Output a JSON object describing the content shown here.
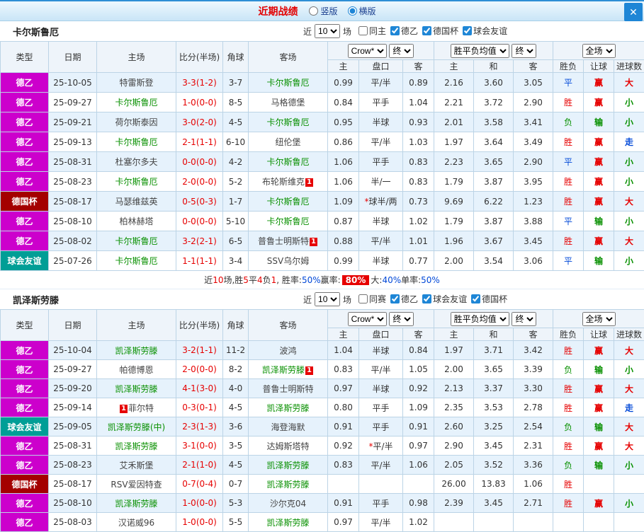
{
  "colors": {
    "accent_blue": "#1e86d6",
    "title_red": "#e30000",
    "league_d2": "#cc00cc",
    "league_cup": "#a40000",
    "league_friendly": "#009e96",
    "team_green": "#089000",
    "win_red": "#e60000",
    "loss_green": "#089000",
    "draw_blue": "#0048d8"
  },
  "topbar": {
    "title": "近期战绩",
    "layout_options": [
      {
        "label": "竖版",
        "selected": false
      },
      {
        "label": "横版",
        "selected": true
      }
    ],
    "close_icon": "✕"
  },
  "color_map": {
    "胜": "c-red",
    "平": "c-blue",
    "负": "c-green",
    "赢": "c-red",
    "输": "c-green",
    "大": "c-red",
    "小": "c-green",
    "走": "c-blue"
  },
  "type_class_map": {
    "德乙": "t-d2",
    "德国杯": "t-cup",
    "球会友谊": "t-fr"
  },
  "table_header": {
    "cols": [
      "类型",
      "日期",
      "主场",
      "比分(半场)",
      "角球",
      "客场"
    ],
    "odds_select": "Crow*",
    "final_select": "终",
    "avg_select": "胜平负均值",
    "scope_select": "全场",
    "sub": [
      "主",
      "盘口",
      "客",
      "主",
      "和",
      "客",
      "胜负",
      "让球",
      "进球数"
    ]
  },
  "sections": [
    {
      "team": "卡尔斯鲁厄",
      "filters": {
        "near": "近",
        "count": "10",
        "unit": "场",
        "checks": [
          {
            "label": "同主",
            "checked": false
          },
          {
            "label": "德乙",
            "checked": true
          },
          {
            "label": "德国杯",
            "checked": true
          },
          {
            "label": "球会友谊",
            "checked": true
          }
        ]
      },
      "rows": [
        {
          "ty": "德乙",
          "dt": "25-10-05",
          "hm": {
            "n": "特雷斯登"
          },
          "sc": "3-3(1-2)",
          "cn": "3-7",
          "aw": {
            "n": "卡尔斯鲁厄",
            "g": 1
          },
          "o1": "0.99",
          "hc": "平/半",
          "o2": "0.89",
          "w": "2.16",
          "d": "3.60",
          "l": "3.05",
          "rs": "平",
          "hr": "赢",
          "gl": "大"
        },
        {
          "ty": "德乙",
          "dt": "25-09-27",
          "hm": {
            "n": "卡尔斯鲁厄",
            "g": 1
          },
          "sc": "1-0(0-0)",
          "cn": "8-5",
          "aw": {
            "n": "马格德堡"
          },
          "o1": "0.84",
          "hc": "平手",
          "o2": "1.04",
          "w": "2.21",
          "d": "3.72",
          "l": "2.90",
          "rs": "胜",
          "hr": "赢",
          "gl": "小"
        },
        {
          "ty": "德乙",
          "dt": "25-09-21",
          "hm": {
            "n": "荷尔斯泰因"
          },
          "sc": "3-0(2-0)",
          "cn": "4-5",
          "aw": {
            "n": "卡尔斯鲁厄",
            "g": 1
          },
          "o1": "0.95",
          "hc": "半球",
          "o2": "0.93",
          "w": "2.01",
          "d": "3.58",
          "l": "3.41",
          "rs": "负",
          "hr": "输",
          "gl": "小"
        },
        {
          "ty": "德乙",
          "dt": "25-09-13",
          "hm": {
            "n": "卡尔斯鲁厄",
            "g": 1
          },
          "sc": "2-1(1-1)",
          "cn": "6-10",
          "aw": {
            "n": "纽伦堡"
          },
          "o1": "0.86",
          "hc": "平/半",
          "o2": "1.03",
          "w": "1.97",
          "d": "3.64",
          "l": "3.49",
          "rs": "胜",
          "hr": "赢",
          "gl": "走"
        },
        {
          "ty": "德乙",
          "dt": "25-08-31",
          "hm": {
            "n": "杜塞尔多夫"
          },
          "sc": "0-0(0-0)",
          "cn": "4-2",
          "aw": {
            "n": "卡尔斯鲁厄",
            "g": 1
          },
          "o1": "1.06",
          "hc": "平手",
          "o2": "0.83",
          "w": "2.23",
          "d": "3.65",
          "l": "2.90",
          "rs": "平",
          "hr": "赢",
          "gl": "小"
        },
        {
          "ty": "德乙",
          "dt": "25-08-23",
          "hm": {
            "n": "卡尔斯鲁厄",
            "g": 1
          },
          "sc": "2-0(0-0)",
          "cn": "5-2",
          "aw": {
            "n": "布轮斯维克",
            "b": "1"
          },
          "o1": "1.06",
          "hc": "半/一",
          "o2": "0.83",
          "w": "1.79",
          "d": "3.87",
          "l": "3.95",
          "rs": "胜",
          "hr": "赢",
          "gl": "小"
        },
        {
          "ty": "德国杯",
          "dt": "25-08-17",
          "hm": {
            "n": "马瑟维兹英"
          },
          "sc": "0-5(0-3)",
          "cn": "1-7",
          "aw": {
            "n": "卡尔斯鲁厄",
            "g": 1
          },
          "o1": "1.09",
          "hc": "*球半/两",
          "o2": "0.73",
          "w": "9.69",
          "d": "6.22",
          "l": "1.23",
          "rs": "胜",
          "hr": "赢",
          "gl": "大"
        },
        {
          "ty": "德乙",
          "dt": "25-08-10",
          "hm": {
            "n": "柏林赫塔"
          },
          "sc": "0-0(0-0)",
          "cn": "5-10",
          "aw": {
            "n": "卡尔斯鲁厄",
            "g": 1
          },
          "o1": "0.87",
          "hc": "半球",
          "o2": "1.02",
          "w": "1.79",
          "d": "3.87",
          "l": "3.88",
          "rs": "平",
          "hr": "输",
          "gl": "小"
        },
        {
          "ty": "德乙",
          "dt": "25-08-02",
          "hm": {
            "n": "卡尔斯鲁厄",
            "g": 1
          },
          "sc": "3-2(2-1)",
          "cn": "6-5",
          "aw": {
            "n": "普鲁士明斯特",
            "b": "1"
          },
          "o1": "0.88",
          "hc": "平/半",
          "o2": "1.01",
          "w": "1.96",
          "d": "3.67",
          "l": "3.45",
          "rs": "胜",
          "hr": "赢",
          "gl": "大"
        },
        {
          "ty": "球会友谊",
          "dt": "25-07-26",
          "hm": {
            "n": "卡尔斯鲁厄",
            "g": 1
          },
          "sc": "1-1(1-1)",
          "cn": "3-4",
          "aw": {
            "n": "SSV乌尔姆"
          },
          "o1": "0.99",
          "hc": "半球",
          "o2": "0.77",
          "w": "2.00",
          "d": "3.54",
          "l": "3.06",
          "rs": "平",
          "hr": "输",
          "gl": "小"
        }
      ],
      "summary": [
        {
          "t": "近"
        },
        {
          "t": "10",
          "c": "num"
        },
        {
          "t": "场,胜"
        },
        {
          "t": "5",
          "c": "num"
        },
        {
          "t": "平"
        },
        {
          "t": "4",
          "c": "num"
        },
        {
          "t": "负"
        },
        {
          "t": "1",
          "c": "num"
        },
        {
          "t": ", 胜率:"
        },
        {
          "t": "50%",
          "c": "pct"
        },
        {
          "t": " 赢率: "
        },
        {
          "t": "80%",
          "c": "hl"
        },
        {
          "t": " 大:"
        },
        {
          "t": "40%",
          "c": "pct"
        },
        {
          "t": " 单率:"
        },
        {
          "t": "50%",
          "c": "pct"
        }
      ]
    },
    {
      "team": "凯泽斯劳滕",
      "filters": {
        "near": "近",
        "count": "10",
        "unit": "场",
        "checks": [
          {
            "label": "同赛",
            "checked": false
          },
          {
            "label": "德乙",
            "checked": true
          },
          {
            "label": "球会友谊",
            "checked": true
          },
          {
            "label": "德国杯",
            "checked": true
          }
        ]
      },
      "rows": [
        {
          "ty": "德乙",
          "dt": "25-10-04",
          "hm": {
            "n": "凯泽斯劳滕",
            "g": 1
          },
          "sc": "3-2(1-1)",
          "cn": "11-2",
          "aw": {
            "n": "波鸿"
          },
          "o1": "1.04",
          "hc": "半球",
          "o2": "0.84",
          "w": "1.97",
          "d": "3.71",
          "l": "3.42",
          "rs": "胜",
          "hr": "赢",
          "gl": "大"
        },
        {
          "ty": "德乙",
          "dt": "25-09-27",
          "hm": {
            "n": "帕德博恩"
          },
          "sc": "2-0(0-0)",
          "cn": "8-2",
          "aw": {
            "n": "凯泽斯劳滕",
            "g": 1,
            "b": "1"
          },
          "o1": "0.83",
          "hc": "平/半",
          "o2": "1.05",
          "w": "2.00",
          "d": "3.65",
          "l": "3.39",
          "rs": "负",
          "hr": "输",
          "gl": "小"
        },
        {
          "ty": "德乙",
          "dt": "25-09-20",
          "hm": {
            "n": "凯泽斯劳滕",
            "g": 1
          },
          "sc": "4-1(3-0)",
          "cn": "4-0",
          "aw": {
            "n": "普鲁士明斯特"
          },
          "o1": "0.97",
          "hc": "半球",
          "o2": "0.92",
          "w": "2.13",
          "d": "3.37",
          "l": "3.30",
          "rs": "胜",
          "hr": "赢",
          "gl": "大"
        },
        {
          "ty": "德乙",
          "dt": "25-09-14",
          "hm": {
            "n": "菲尔特",
            "b": "1",
            "bp": "pre"
          },
          "sc": "0-3(0-1)",
          "cn": "4-5",
          "aw": {
            "n": "凯泽斯劳滕",
            "g": 1
          },
          "o1": "0.80",
          "hc": "平手",
          "o2": "1.09",
          "w": "2.35",
          "d": "3.53",
          "l": "2.78",
          "rs": "胜",
          "hr": "赢",
          "gl": "走"
        },
        {
          "ty": "球会友谊",
          "dt": "25-09-05",
          "hm": {
            "n": "凯泽斯劳滕(中)",
            "g": 1
          },
          "sc": "2-3(1-3)",
          "cn": "3-6",
          "aw": {
            "n": "海登海默"
          },
          "o1": "0.91",
          "hc": "平手",
          "o2": "0.91",
          "w": "2.60",
          "d": "3.25",
          "l": "2.54",
          "rs": "负",
          "hr": "输",
          "gl": "大"
        },
        {
          "ty": "德乙",
          "dt": "25-08-31",
          "hm": {
            "n": "凯泽斯劳滕",
            "g": 1
          },
          "sc": "3-1(0-0)",
          "cn": "3-5",
          "aw": {
            "n": "达姆斯塔特"
          },
          "o1": "0.92",
          "hc": "*平/半",
          "o2": "0.97",
          "w": "2.90",
          "d": "3.45",
          "l": "2.31",
          "rs": "胜",
          "hr": "赢",
          "gl": "大"
        },
        {
          "ty": "德乙",
          "dt": "25-08-23",
          "hm": {
            "n": "艾禾斯堡"
          },
          "sc": "2-1(1-0)",
          "cn": "4-5",
          "aw": {
            "n": "凯泽斯劳滕",
            "g": 1
          },
          "o1": "0.83",
          "hc": "平/半",
          "o2": "1.06",
          "w": "2.05",
          "d": "3.52",
          "l": "3.36",
          "rs": "负",
          "hr": "输",
          "gl": "小"
        },
        {
          "ty": "德国杯",
          "dt": "25-08-17",
          "hm": {
            "n": "RSV爱因特查"
          },
          "sc": "0-7(0-4)",
          "cn": "0-7",
          "aw": {
            "n": "凯泽斯劳滕",
            "g": 1
          },
          "o1": "",
          "hc": "",
          "o2": "",
          "w": "26.00",
          "d": "13.83",
          "l": "1.06",
          "rs": "胜",
          "hr": "",
          "gl": ""
        },
        {
          "ty": "德乙",
          "dt": "25-08-10",
          "hm": {
            "n": "凯泽斯劳滕",
            "g": 1
          },
          "sc": "1-0(0-0)",
          "cn": "5-3",
          "aw": {
            "n": "沙尔克04"
          },
          "o1": "0.91",
          "hc": "平手",
          "o2": "0.98",
          "w": "2.39",
          "d": "3.45",
          "l": "2.71",
          "rs": "胜",
          "hr": "赢",
          "gl": "小"
        },
        {
          "ty": "德乙",
          "dt": "25-08-03",
          "hm": {
            "n": "汉诺威96"
          },
          "sc": "1-0(0-0)",
          "cn": "5-5",
          "aw": {
            "n": "凯泽斯劳滕",
            "g": 1
          },
          "o1": "0.97",
          "hc": "平/半",
          "o2": "1.02",
          "w": "",
          "d": "",
          "l": "",
          "rs": "",
          "hr": "",
          "gl": ""
        }
      ],
      "summary": []
    }
  ]
}
